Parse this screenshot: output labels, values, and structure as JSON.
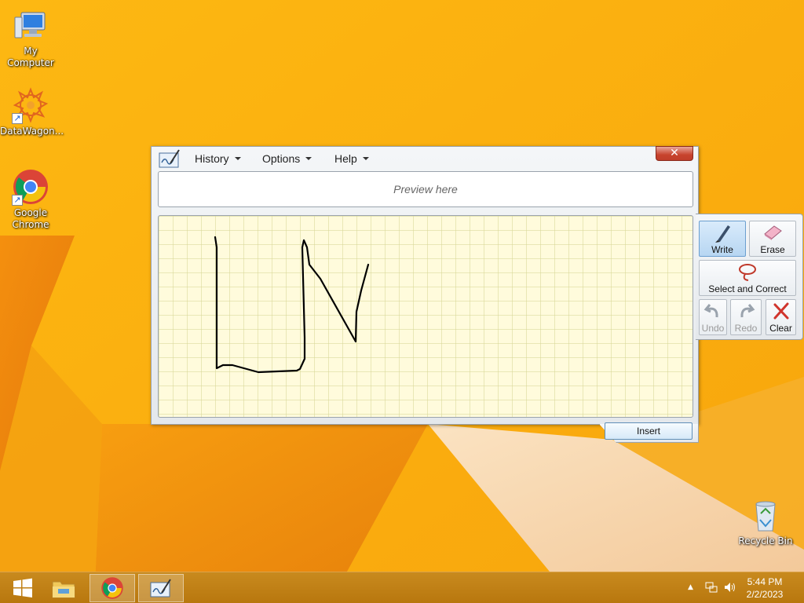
{
  "desktop": {
    "icons": [
      {
        "label": "My Computer",
        "icon": "computer-icon"
      },
      {
        "label": "DataWagon...",
        "icon": "datawagon-icon"
      },
      {
        "label": "Google Chrome",
        "icon": "chrome-icon"
      },
      {
        "label": "Recycle Bin",
        "icon": "recycle-bin-icon"
      }
    ],
    "shortcut_arrow": "↗"
  },
  "tip": {
    "menu": {
      "history": "History",
      "options": "Options",
      "help": "Help"
    },
    "close_glyph": "✕",
    "preview_placeholder": "Preview here",
    "ink_color": "#000000",
    "tools": {
      "write": "Write",
      "erase": "Erase",
      "select_and_correct": "Select and Correct",
      "undo": "Undo",
      "redo": "Redo",
      "clear": "Clear"
    },
    "insert": "Insert"
  },
  "taskbar": {
    "buttons": [
      "start-icon",
      "file-explorer-icon",
      "chrome-icon",
      "input-panel-icon"
    ],
    "active": "chrome-icon",
    "tray": {
      "show_hidden": "▲",
      "time": "5:44 PM",
      "date": "2/2/2023"
    }
  },
  "colors": {
    "wallpaper": "#fbb30f",
    "taskbar": "#c0811a",
    "accent_active": "#b7d6f2",
    "close_red": "#c7432d"
  }
}
